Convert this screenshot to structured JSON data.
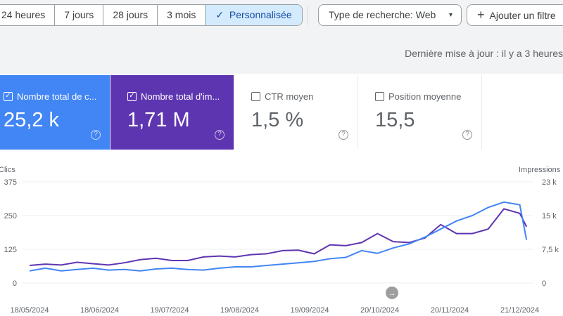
{
  "date_range": {
    "options": [
      "24 heures",
      "7 jours",
      "28 jours",
      "3 mois",
      "Personnalisée"
    ],
    "selected": "Personnalisée",
    "check_icon": "✓"
  },
  "filters": {
    "search_type": "Type de recherche: Web",
    "add_filter": "Ajouter un filtre",
    "plus_icon": "+",
    "dropdown_icon": "▾"
  },
  "updated": "Dernière mise à jour : il y a 3 heures",
  "metrics": [
    {
      "label": "Nombre total de c...",
      "value": "25,2 k",
      "checked": true,
      "color": "#4285f4"
    },
    {
      "label": "Nombre total d'im...",
      "value": "1,71 M",
      "checked": true,
      "color": "#5e35b1"
    },
    {
      "label": "CTR moyen",
      "value": "1,5 %",
      "checked": false
    },
    {
      "label": "Position moyenne",
      "value": "15,5",
      "checked": false
    }
  ],
  "chart_data": {
    "type": "line",
    "left_axis": {
      "label": "Clics",
      "ticks": [
        "0",
        "125",
        "250",
        "375"
      ],
      "range": [
        0,
        375
      ]
    },
    "right_axis": {
      "label": "Impressions",
      "ticks": [
        "0",
        "7,5 k",
        "15 k",
        "23 k"
      ],
      "range": [
        0,
        22500
      ]
    },
    "x_ticks": [
      "18/05/2024",
      "18/06/2024",
      "19/07/2024",
      "19/08/2024",
      "19/09/2024",
      "20/10/2024",
      "20/11/2024",
      "21/12/2024"
    ],
    "x": [
      "18/05",
      "25/05",
      "01/06",
      "08/06",
      "15/06",
      "22/06",
      "29/06",
      "06/07",
      "13/07",
      "20/07",
      "27/07",
      "03/08",
      "10/08",
      "17/08",
      "24/08",
      "31/08",
      "07/09",
      "14/09",
      "21/09",
      "28/09",
      "05/10",
      "12/10",
      "19/10",
      "26/10",
      "02/11",
      "09/11",
      "16/11",
      "23/11",
      "30/11",
      "07/12",
      "14/12",
      "21/12",
      "24/12"
    ],
    "grid": true,
    "series": [
      {
        "name": "Clics",
        "axis": "left",
        "color": "#4285f4",
        "values": [
          45,
          55,
          45,
          50,
          55,
          48,
          50,
          45,
          52,
          55,
          50,
          48,
          55,
          60,
          60,
          65,
          70,
          75,
          80,
          90,
          95,
          120,
          110,
          130,
          145,
          170,
          200,
          230,
          250,
          280,
          300,
          290,
          160
        ]
      },
      {
        "name": "Impressions",
        "axis": "right",
        "color": "#5e35b1",
        "values": [
          3900,
          4200,
          4000,
          4600,
          4300,
          4000,
          4500,
          5200,
          5500,
          5000,
          5000,
          5800,
          6000,
          5800,
          6300,
          6500,
          7200,
          7300,
          6500,
          8500,
          8300,
          9000,
          11000,
          9200,
          9000,
          10000,
          13000,
          11000,
          11000,
          12000,
          16500,
          15500,
          12500
        ]
      }
    ]
  },
  "scroll_icon": "→"
}
